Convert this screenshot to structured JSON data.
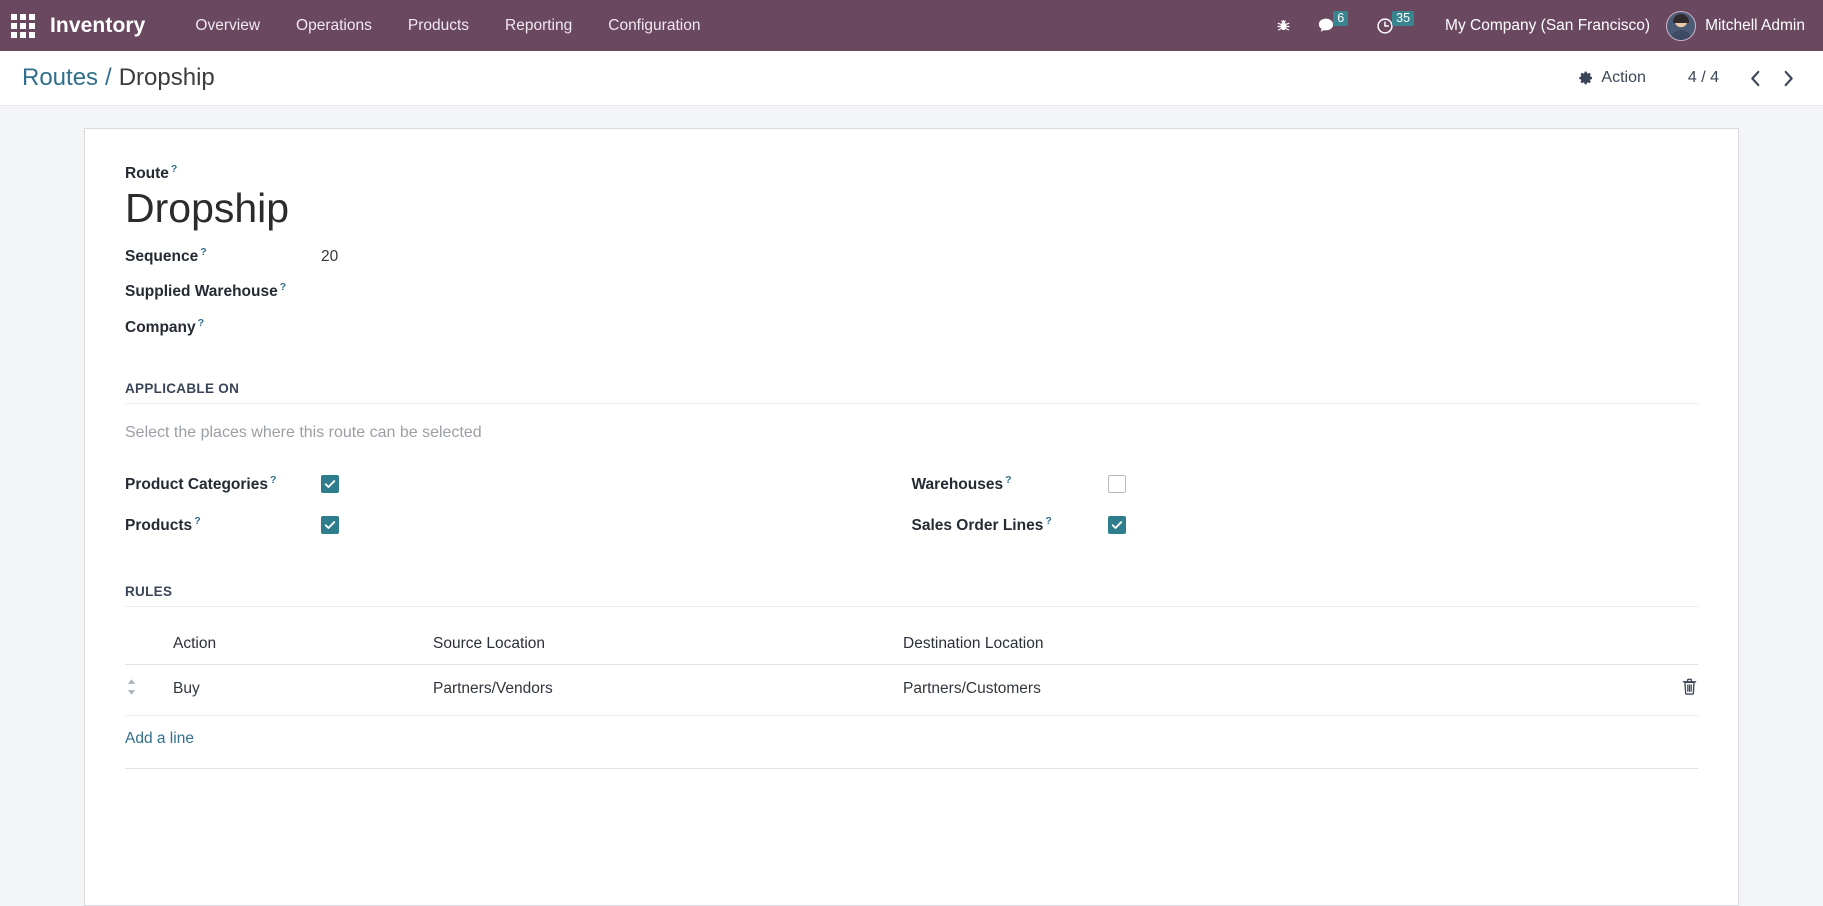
{
  "navbar": {
    "apps_icon": "apps-grid-icon",
    "brand": "Inventory",
    "menu": [
      {
        "label": "Overview"
      },
      {
        "label": "Operations"
      },
      {
        "label": "Products"
      },
      {
        "label": "Reporting"
      },
      {
        "label": "Configuration"
      }
    ],
    "debug_icon": "bug-icon",
    "messages": {
      "icon": "chat-bubble-icon",
      "count": "6"
    },
    "activities": {
      "icon": "clock-icon",
      "count": "35"
    },
    "company": "My Company (San Francisco)",
    "avatar_icon": "user-avatar",
    "user": "Mitchell Admin",
    "accent_color": "#6a4860",
    "badge_color": "#38848f"
  },
  "control_panel": {
    "breadcrumb": {
      "parent": "Routes",
      "separator": "/",
      "current": "Dropship"
    },
    "action": {
      "icon": "gear-icon",
      "label": "Action"
    },
    "pager": {
      "value": "4 / 4",
      "prev_icon": "chevron-left-icon",
      "next_icon": "chevron-right-icon"
    },
    "link_color": "#31708d"
  },
  "form": {
    "route_label": "Route",
    "route_name": "Dropship",
    "fields": [
      {
        "label": "Sequence",
        "value": "20"
      },
      {
        "label": "Supplied Warehouse",
        "value": ""
      },
      {
        "label": "Company",
        "value": ""
      }
    ],
    "help_marker": "?"
  },
  "applicable_on": {
    "title": "APPLICABLE ON",
    "help": "Select the places where this route can be selected",
    "left": [
      {
        "label": "Product Categories",
        "checked": true
      },
      {
        "label": "Products",
        "checked": true
      }
    ],
    "right": [
      {
        "label": "Warehouses",
        "checked": false
      },
      {
        "label": "Sales Order Lines",
        "checked": true
      }
    ],
    "checked_color": "#2e7d8c"
  },
  "rules": {
    "title": "RULES",
    "columns": [
      "Action",
      "Source Location",
      "Destination Location"
    ],
    "rows": [
      {
        "handle_icon": "drag-handle-icon",
        "action": "Buy",
        "source_location": "Partners/Vendors",
        "destination_location": "Partners/Customers",
        "delete_icon": "trash-icon"
      }
    ],
    "add_line": "Add a line"
  }
}
